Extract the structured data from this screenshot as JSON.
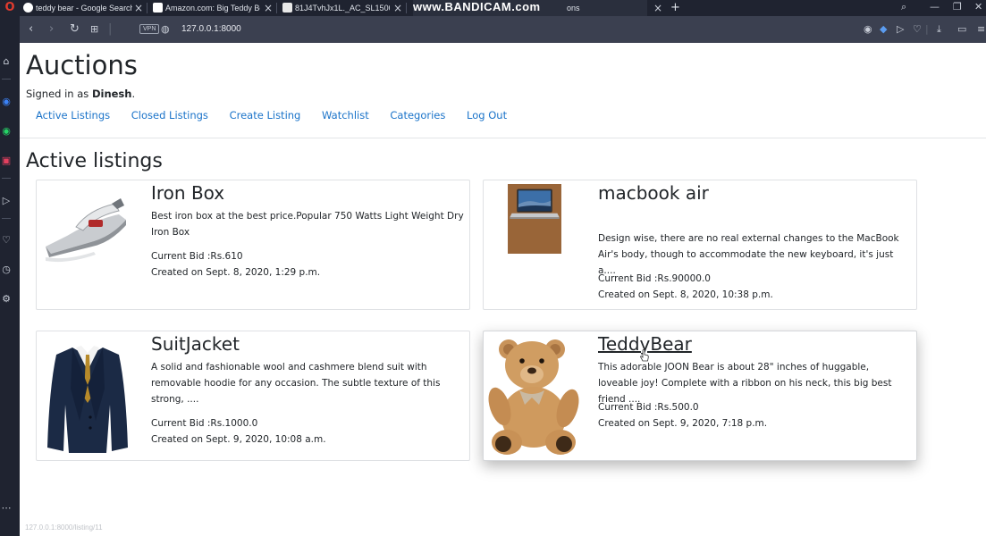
{
  "browser": {
    "tabs": [
      {
        "title": "teddy bear - Google Search",
        "fav_color": "#ffffff"
      },
      {
        "title": "Amazon.com: Big Teddy Be",
        "fav_color": "#ffffff"
      },
      {
        "title": "81J4TvhJx1L._AC_SL1500_.jp",
        "fav_color": "#e8e8e8"
      },
      {
        "title": "ons",
        "fav_color": "#c57c2a"
      }
    ],
    "watermark": "www.BANDICAM.com",
    "url": "127.0.0.1:8000",
    "vpn_label": "VPN",
    "status_url": "127.0.0.1:8000/listing/11"
  },
  "site": {
    "title": "Auctions",
    "signed_in_prefix": "Signed in as",
    "username": "Dinesh",
    "nav": [
      "Active Listings",
      "Closed Listings",
      "Create Listing",
      "Watchlist",
      "Categories",
      "Log Out"
    ],
    "section_title": "Active listings"
  },
  "listings": [
    {
      "name": "Iron Box",
      "description": "Best iron box at the best price.Popular 750 Watts Light Weight Dry Iron Box",
      "bid": "Current Bid :Rs.610",
      "created": "Created on Sept. 8, 2020, 1:29 p.m.",
      "image": "iron-box-image"
    },
    {
      "name": "macbook air",
      "description": "Design wise, there are no real external changes to the MacBook Air's body, though to accommodate the new keyboard, it's just a....",
      "bid": "Current Bid :Rs.90000.0",
      "created": "Created on Sept. 8, 2020, 10:38 p.m.",
      "image": "laptop-image"
    },
    {
      "name": "SuitJacket",
      "description": "A solid and fashionable wool and cashmere blend suit with removable hoodie for any occasion. The subtle texture of this strong, ....",
      "bid": "Current Bid :Rs.1000.0",
      "created": "Created on Sept. 9, 2020, 10:08 a.m.",
      "image": "suit-jacket-image"
    },
    {
      "name": "TeddyBear",
      "description": "This adorable JOON Bear is about 28\" inches of huggable, loveable joy! Complete with a ribbon on his neck, this big best friend ....",
      "bid": "Current Bid :Rs.500.0",
      "created": "Created on Sept. 9, 2020, 7:18 p.m.",
      "image": "teddy-bear-image"
    }
  ]
}
